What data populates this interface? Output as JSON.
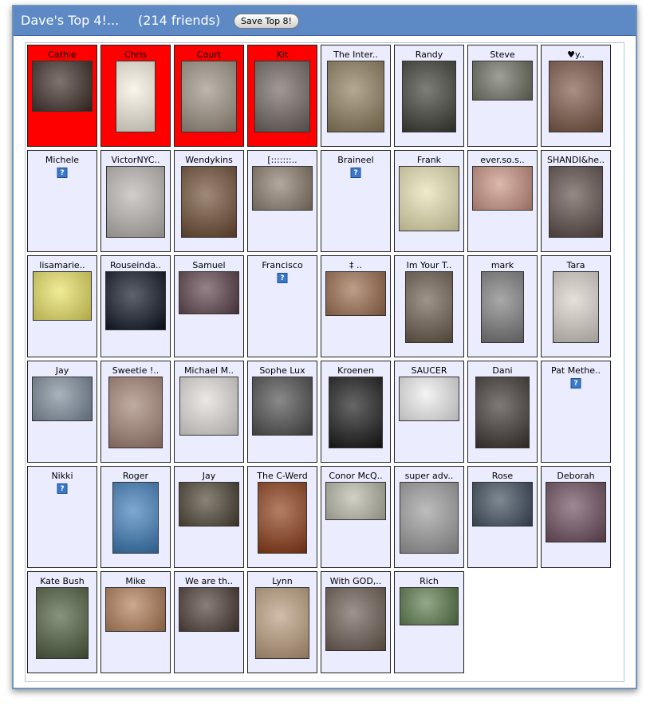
{
  "header": {
    "title": "Dave's Top 4!...",
    "friend_count": "(214 friends)",
    "save_label": "Save Top 8!"
  },
  "colors": {
    "header_bg": "#5d89c5",
    "top_cell_bg": "#ff0000",
    "cell_bg": "#ececff",
    "unknown_icon": "#3a78c8"
  },
  "friends": [
    {
      "name": "Cathie",
      "icon": "photo",
      "top": true,
      "photo_color": "#3b2a24"
    },
    {
      "name": "Chris",
      "icon": "cartoon-photo",
      "top": true,
      "photo_color": "#f6f0e0"
    },
    {
      "name": "Court",
      "icon": "photo",
      "top": true,
      "photo_color": "#9a8f80"
    },
    {
      "name": "Kit",
      "icon": "photo",
      "top": true,
      "photo_color": "#6d625c"
    },
    {
      "name": "The Inter..",
      "icon": "photo",
      "top": false,
      "photo_color": "#8c7a5a"
    },
    {
      "name": "Randy",
      "icon": "photo",
      "top": false,
      "photo_color": "#3a3a32"
    },
    {
      "name": "Steve",
      "icon": "photo",
      "top": false,
      "photo_color": "#6c6e5e"
    },
    {
      "name": "♥y..",
      "icon": "photo",
      "top": false,
      "photo_color": "#7a5544"
    },
    {
      "name": "Michele",
      "icon": "question-icon",
      "top": false
    },
    {
      "name": "VictorNYC..",
      "icon": "photo",
      "top": false,
      "photo_color": "#b8b4b0"
    },
    {
      "name": "Wendykins",
      "icon": "photo",
      "top": false,
      "photo_color": "#6b4a30"
    },
    {
      "name": "[:::::::..",
      "icon": "photo",
      "top": false,
      "photo_color": "#8a7a6a"
    },
    {
      "name": "Braineel",
      "icon": "question-icon",
      "top": false
    },
    {
      "name": "Frank",
      "icon": "photo",
      "top": false,
      "photo_color": "#e6e0b0"
    },
    {
      "name": "ever.so.s..",
      "icon": "photo",
      "top": false,
      "photo_color": "#c89080"
    },
    {
      "name": "SHANDI&he..",
      "icon": "photo",
      "top": false,
      "photo_color": "#5a4a44"
    },
    {
      "name": "lisamarie..",
      "icon": "photo",
      "top": false,
      "photo_color": "#e8e060"
    },
    {
      "name": "Rouseinda..",
      "icon": "photo",
      "top": false,
      "photo_color": "#0a1020"
    },
    {
      "name": "Samuel",
      "icon": "photo",
      "top": false,
      "photo_color": "#5a4048"
    },
    {
      "name": "Francisco",
      "icon": "question-icon",
      "top": false
    },
    {
      "name": "‡ ..",
      "icon": "photo",
      "top": false,
      "photo_color": "#9a6a4a"
    },
    {
      "name": "Im Your T..",
      "icon": "photo",
      "top": false,
      "photo_color": "#6a5a4a"
    },
    {
      "name": "mark",
      "icon": "photo",
      "top": false,
      "photo_color": "#7a7a7a"
    },
    {
      "name": "Tara",
      "icon": "photo",
      "top": false,
      "photo_color": "#d8d0c8"
    },
    {
      "name": "Jay",
      "icon": "photo",
      "top": false,
      "photo_color": "#7a8a9a"
    },
    {
      "name": "Sweetie !..",
      "icon": "photo",
      "top": false,
      "photo_color": "#a08070"
    },
    {
      "name": "Michael M..",
      "icon": "photo",
      "top": false,
      "photo_color": "#e0dcd8"
    },
    {
      "name": "Sophe Lux",
      "icon": "photo",
      "top": false,
      "photo_color": "#4a4a4a"
    },
    {
      "name": "Kroenen",
      "icon": "photo",
      "top": false,
      "photo_color": "#151515"
    },
    {
      "name": "SAUCER",
      "icon": "photo",
      "top": false,
      "photo_color": "#eeeeee"
    },
    {
      "name": "Dani",
      "icon": "photo",
      "top": false,
      "photo_color": "#3a3230"
    },
    {
      "name": "Pat Methe..",
      "icon": "question-icon",
      "top": false
    },
    {
      "name": "Nikki",
      "icon": "question-icon",
      "top": false
    },
    {
      "name": "Roger",
      "icon": "photo",
      "top": false,
      "photo_color": "#3a7ab8"
    },
    {
      "name": "Jay",
      "icon": "photo",
      "top": false,
      "photo_color": "#4a4030"
    },
    {
      "name": "The C-Werd",
      "icon": "photo",
      "top": false,
      "photo_color": "#8a3a14"
    },
    {
      "name": "Conor McQ..",
      "icon": "photo",
      "top": false,
      "photo_color": "#b8b8a8"
    },
    {
      "name": "super adv..",
      "icon": "photo",
      "top": false,
      "photo_color": "#9a9a9a"
    },
    {
      "name": "Rose",
      "icon": "photo",
      "top": false,
      "photo_color": "#3a4a5a"
    },
    {
      "name": "Deborah",
      "icon": "photo",
      "top": false,
      "photo_color": "#6a4a5a"
    },
    {
      "name": "Kate Bush",
      "icon": "photo",
      "top": false,
      "photo_color": "#4a5a3a"
    },
    {
      "name": "Mike",
      "icon": "photo",
      "top": false,
      "photo_color": "#b07a54"
    },
    {
      "name": "We are th..",
      "icon": "photo",
      "top": false,
      "photo_color": "#4a3a32"
    },
    {
      "name": "Lynn",
      "icon": "photo",
      "top": false,
      "photo_color": "#b89a7a"
    },
    {
      "name": "With GOD,..",
      "icon": "photo",
      "top": false,
      "photo_color": "#6a5a50"
    },
    {
      "name": "Rich",
      "icon": "photo",
      "top": false,
      "photo_color": "#5a7a4a"
    }
  ]
}
